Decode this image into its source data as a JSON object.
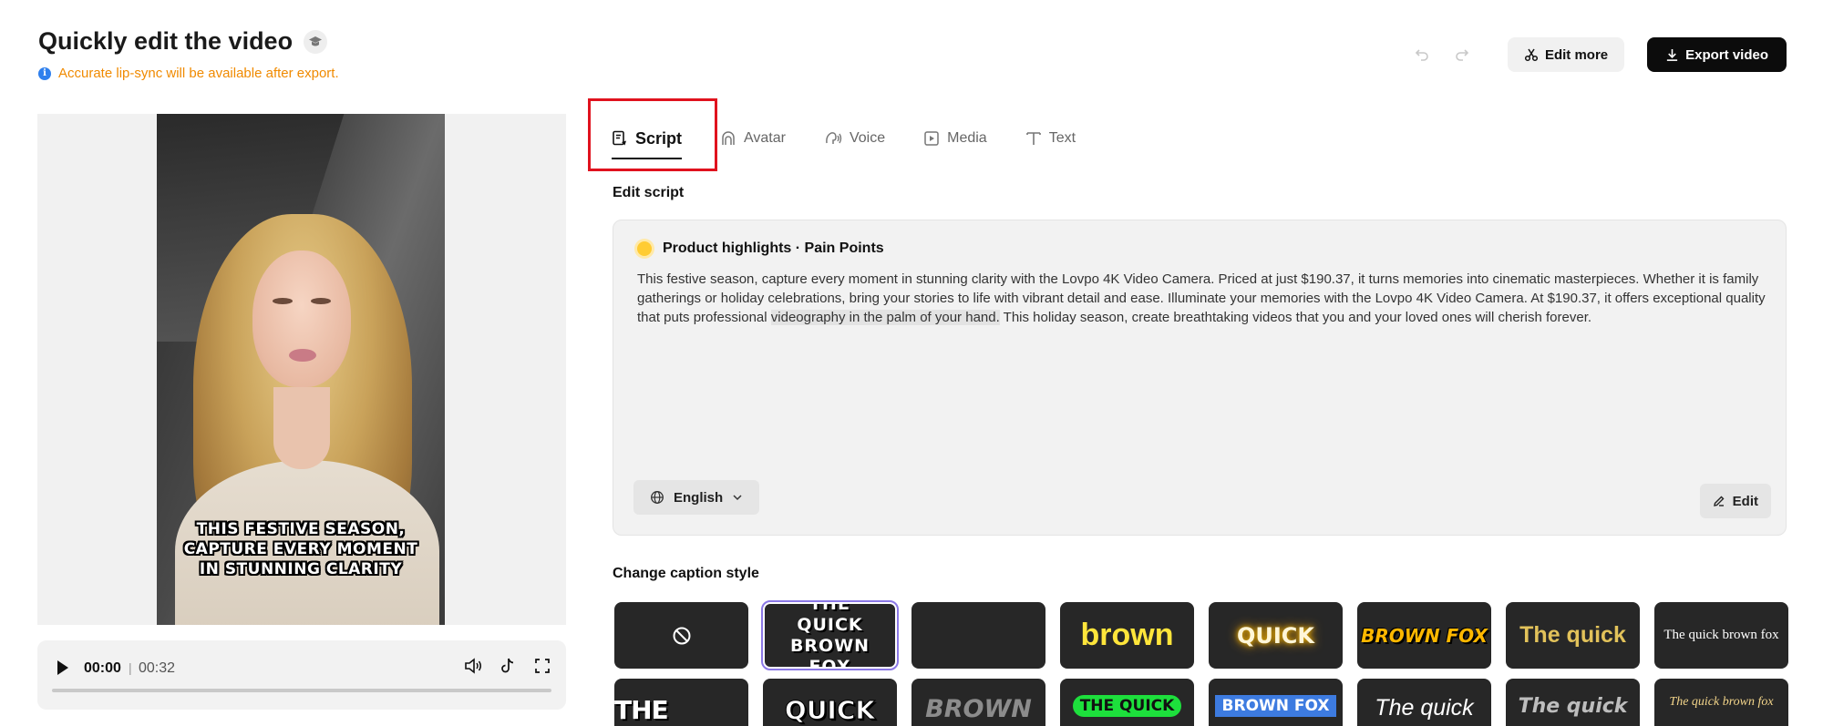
{
  "header": {
    "title": "Quickly edit the video",
    "notice": "Accurate lip-sync will be available after export.",
    "edit_more_label": "Edit more",
    "export_label": "Export video"
  },
  "preview": {
    "caption_lines": [
      "THIS FESTIVE SEASON,",
      "CAPTURE EVERY MOMENT",
      "IN STUNNING CLARITY"
    ],
    "time_current": "00:00",
    "time_separator": "|",
    "time_total": "00:32"
  },
  "tabs": [
    {
      "label": "Script",
      "active": true
    },
    {
      "label": "Avatar",
      "active": false
    },
    {
      "label": "Voice",
      "active": false
    },
    {
      "label": "Media",
      "active": false
    },
    {
      "label": "Text",
      "active": false
    }
  ],
  "script": {
    "section_label": "Edit script",
    "heading": "Product highlights · Pain Points",
    "text_before": "This festive season, capture every moment in stunning clarity with the Lovpo 4K Video Camera. Priced at just $190.37, it turns memories into cinematic masterpieces. Whether it is family gatherings or holiday celebrations, bring your stories to life with vibrant detail and ease. Illuminate your memories with the Lovpo 4K Video Camera. At $190.37, it offers exceptional quality that puts professional ",
    "text_highlight": "videography in the palm of your hand.",
    "text_after": " This holiday season, create breathtaking videos that you and your loved ones will cherish forever.",
    "language": "English",
    "edit_label": "Edit"
  },
  "captions": {
    "section_label": "Change caption style",
    "row1": [
      "",
      "THE QUICK BROWN FOX",
      "",
      "brown",
      "QUICK",
      "BROWN FOX",
      "The quick",
      "The quick brown fox"
    ],
    "row2": [
      "THE QUICK",
      "QUICK",
      "BROWN",
      "THE QUICK",
      "BROWN FOX",
      "The quick",
      "The quick",
      "The quick brown fox"
    ]
  }
}
